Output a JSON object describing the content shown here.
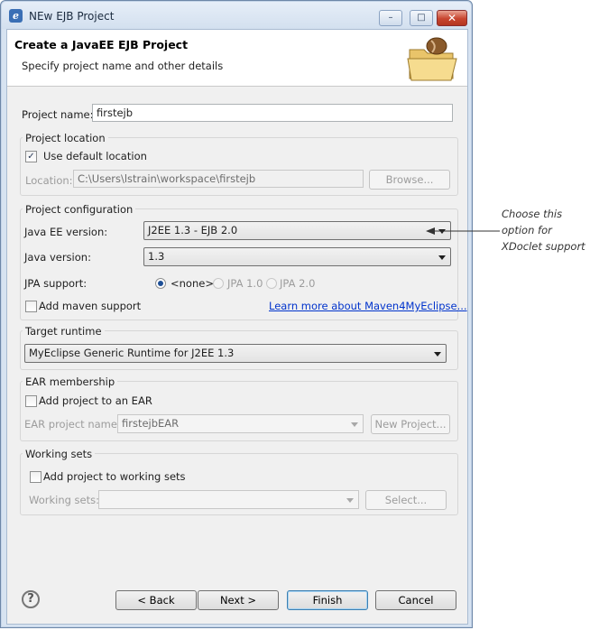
{
  "window": {
    "title": "NEw EJB Project",
    "icon": "eclipse-icon",
    "controls": {
      "minimize": "–",
      "maximize": "□",
      "close": "✕"
    }
  },
  "header": {
    "title": "Create a JavaEE EJB Project",
    "subtitle": "Specify project name and other details",
    "image": "folder-with-bean-icon"
  },
  "project_name": {
    "label": "Project name:",
    "value": "firstejb"
  },
  "project_location": {
    "group_label": "Project location",
    "use_default": {
      "label": "Use default location",
      "checked": true
    },
    "location_label": "Location:",
    "location_value": "C:\\Users\\lstrain\\workspace\\firstejb",
    "browse_label": "Browse..."
  },
  "project_configuration": {
    "group_label": "Project configuration",
    "java_ee_label": "Java EE version:",
    "java_ee_value": "J2EE 1.3 - EJB 2.0",
    "java_version_label": "Java version:",
    "java_version_value": "1.3",
    "jpa_label": "JPA support:",
    "jpa_options": [
      "<none>",
      "JPA 1.0",
      "JPA 2.0"
    ],
    "jpa_selected": "<none>",
    "maven_label": "Add maven support",
    "maven_link": "Learn more about Maven4MyEclipse..."
  },
  "target_runtime": {
    "group_label": "Target runtime",
    "value": "MyEclipse Generic Runtime for J2EE 1.3"
  },
  "ear_membership": {
    "group_label": "EAR membership",
    "add_label": "Add project to an EAR",
    "ear_name_label": "EAR project name:",
    "ear_name_value": "firstejbEAR",
    "new_project_label": "New Project..."
  },
  "working_sets": {
    "group_label": "Working sets",
    "add_label": "Add project to working sets",
    "sets_label": "Working sets:",
    "sets_value": "",
    "select_label": "Select..."
  },
  "footer": {
    "help_symbol": "?",
    "back_label": "< Back",
    "next_label": "Next >",
    "finish_label": "Finish",
    "cancel_label": "Cancel"
  },
  "annotation": {
    "lines": [
      "Choose this",
      "option for",
      "XDoclet support"
    ]
  }
}
